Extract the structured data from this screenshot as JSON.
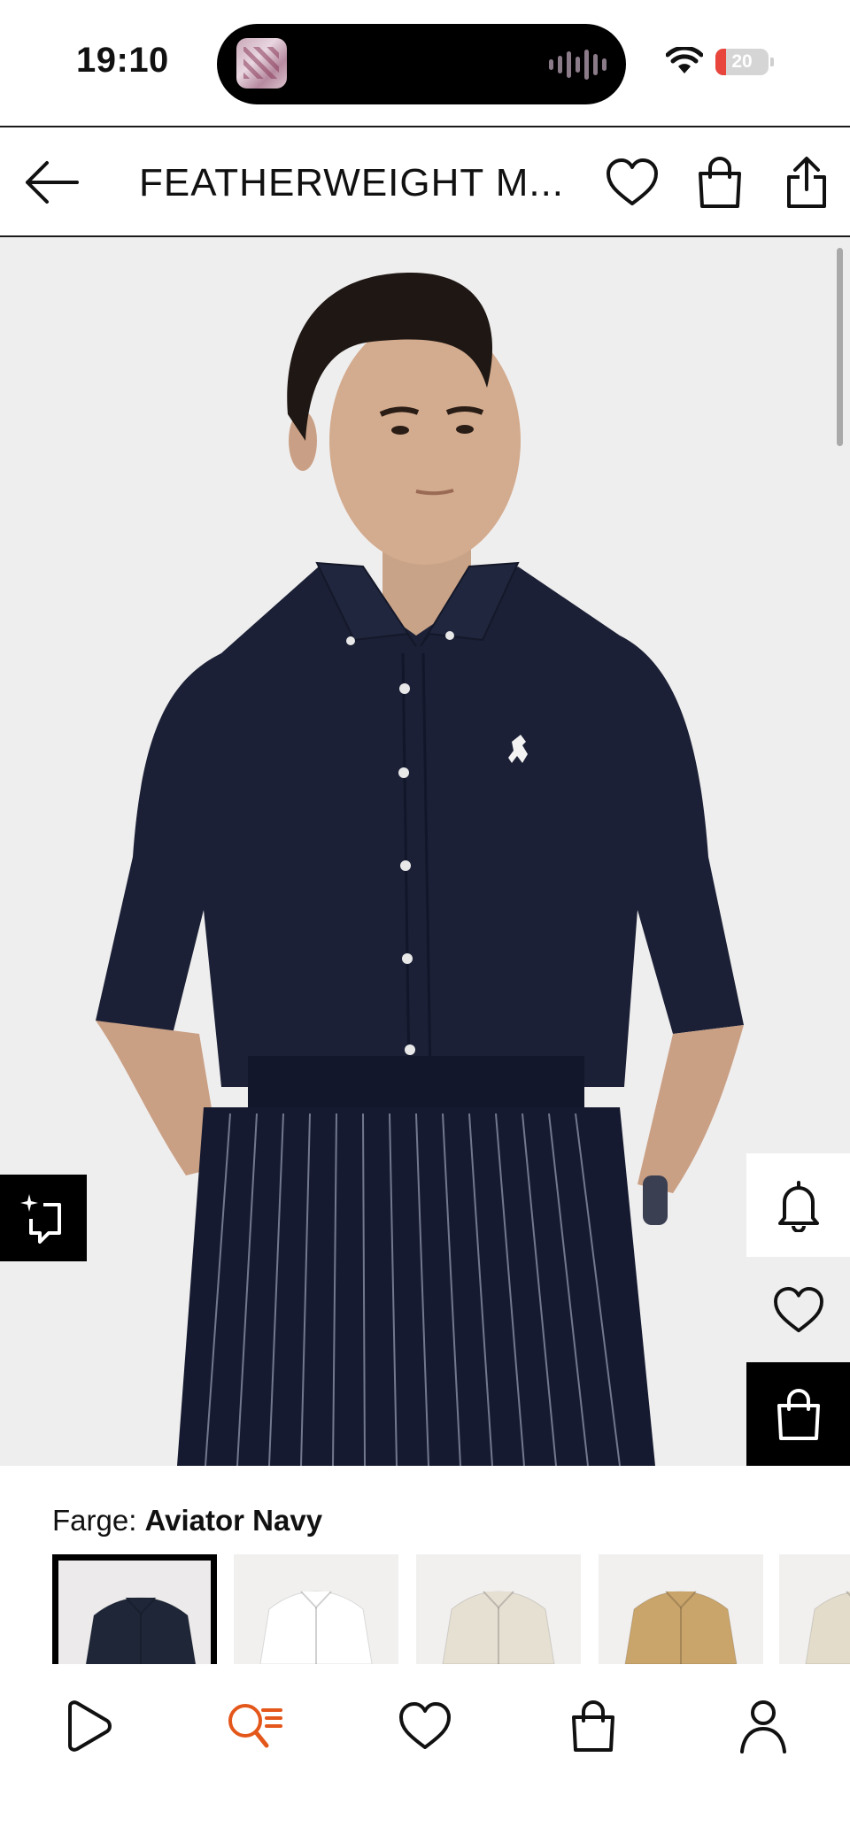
{
  "status_bar": {
    "time": "19:10",
    "battery_level": "20",
    "battery_color": "#e8453c",
    "icons": [
      "now-playing-thumbnail",
      "audio-waveform-icon",
      "wifi-icon",
      "battery-icon"
    ]
  },
  "header": {
    "title": "FEATHERWEIGHT M...",
    "icons": [
      "back-arrow-icon",
      "heart-icon",
      "shopping-bag-icon",
      "share-icon"
    ]
  },
  "product_image": {
    "carousel_progress": 0.15,
    "side_actions": [
      "bell-icon",
      "heart-icon",
      "shopping-bag-icon"
    ],
    "ai_button_icon": "sparkle-crop-icon"
  },
  "color_selector": {
    "label": "Farge:",
    "selected": "Aviator Navy",
    "swatches": [
      {
        "color": "#1e2638",
        "selected": true
      },
      {
        "color": "#ffffff",
        "selected": false
      },
      {
        "color": "#e6e0d3",
        "selected": false
      },
      {
        "color": "#c9a46b",
        "selected": false
      },
      {
        "color": "#e3dccb",
        "selected": false
      }
    ]
  },
  "bottom_nav": {
    "items": [
      "play-icon",
      "search-list-icon",
      "heart-icon",
      "shopping-bag-icon",
      "profile-icon"
    ],
    "active": "search-list-icon",
    "active_color": "#e4571b"
  }
}
